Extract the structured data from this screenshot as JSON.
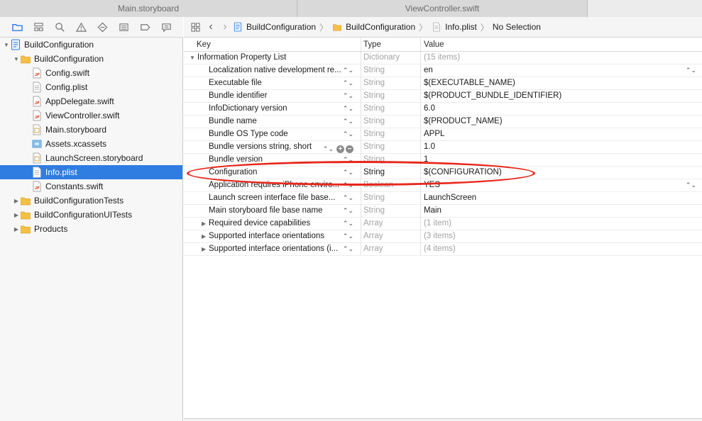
{
  "tabs": [
    {
      "label": "Main.storyboard"
    },
    {
      "label": "ViewController.swift"
    }
  ],
  "navigator_toolbar": {
    "icons": [
      "folder-icon",
      "hierarchy-icon",
      "search-icon",
      "warning-icon",
      "test-diamond-icon",
      "debug-list-icon",
      "breakpoint-icon",
      "report-icon"
    ]
  },
  "tree": [
    {
      "label": "BuildConfiguration",
      "level": 0,
      "icon": "project-icon",
      "expanded": true
    },
    {
      "label": "BuildConfiguration",
      "level": 1,
      "icon": "folder-icon",
      "expanded": true
    },
    {
      "label": "Config.swift",
      "level": 2,
      "icon": "swift-file-icon"
    },
    {
      "label": "Config.plist",
      "level": 2,
      "icon": "plist-file-icon"
    },
    {
      "label": "AppDelegate.swift",
      "level": 2,
      "icon": "swift-file-icon"
    },
    {
      "label": "ViewController.swift",
      "level": 2,
      "icon": "swift-file-icon"
    },
    {
      "label": "Main.storyboard",
      "level": 2,
      "icon": "storyboard-file-icon"
    },
    {
      "label": "Assets.xcassets",
      "level": 2,
      "icon": "assets-icon"
    },
    {
      "label": "LaunchScreen.storyboard",
      "level": 2,
      "icon": "storyboard-file-icon"
    },
    {
      "label": "Info.plist",
      "level": 2,
      "icon": "plist-file-icon",
      "selected": true
    },
    {
      "label": "Constants.swift",
      "level": 2,
      "icon": "swift-file-icon"
    },
    {
      "label": "BuildConfigurationTests",
      "level": 1,
      "icon": "folder-icon",
      "expanded": false
    },
    {
      "label": "BuildConfigurationUITests",
      "level": 1,
      "icon": "folder-icon",
      "expanded": false
    },
    {
      "label": "Products",
      "level": 1,
      "icon": "folder-icon",
      "expanded": false
    }
  ],
  "jumpbar": {
    "project": "BuildConfiguration",
    "group": "BuildConfiguration",
    "file": "Info.plist",
    "selection": "No Selection"
  },
  "plist": {
    "headers": {
      "key": "Key",
      "type": "Type",
      "value": "Value"
    },
    "root": {
      "key": "Information Property List",
      "type": "Dictionary",
      "value": "(15 items)"
    },
    "rows": [
      {
        "key": "Localization native development re...",
        "type": "String",
        "value": "en",
        "value_stepper": true
      },
      {
        "key": "Executable file",
        "type": "String",
        "value": "$(EXECUTABLE_NAME)"
      },
      {
        "key": "Bundle identifier",
        "type": "String",
        "value": "$(PRODUCT_BUNDLE_IDENTIFIER)"
      },
      {
        "key": "InfoDictionary version",
        "type": "String",
        "value": "6.0"
      },
      {
        "key": "Bundle name",
        "type": "String",
        "value": "$(PRODUCT_NAME)"
      },
      {
        "key": "Bundle OS Type code",
        "type": "String",
        "value": "APPL"
      },
      {
        "key": "Bundle versions string, short",
        "type": "String",
        "value": "1.0",
        "hover": true
      },
      {
        "key": "Bundle version",
        "type": "String",
        "value": "1"
      },
      {
        "key": "Configuration",
        "type": "String",
        "value": "$(CONFIGURATION)",
        "highlight": true
      },
      {
        "key": "Application requires iPhone enviro...",
        "type": "Boolean",
        "value": "YES",
        "value_stepper": true
      },
      {
        "key": "Launch screen interface file base...",
        "type": "String",
        "value": "LaunchScreen"
      },
      {
        "key": "Main storyboard file base name",
        "type": "String",
        "value": "Main"
      },
      {
        "key": "Required device capabilities",
        "type": "Array",
        "value": "(1 item)",
        "group": true
      },
      {
        "key": "Supported interface orientations",
        "type": "Array",
        "value": "(3 items)",
        "group": true
      },
      {
        "key": "Supported interface orientations (i...",
        "type": "Array",
        "value": "(4 items)",
        "group": true
      }
    ]
  },
  "colors": {
    "selection": "#2f7de1",
    "annotation": "#e8271c",
    "folder": "#f5c046"
  }
}
